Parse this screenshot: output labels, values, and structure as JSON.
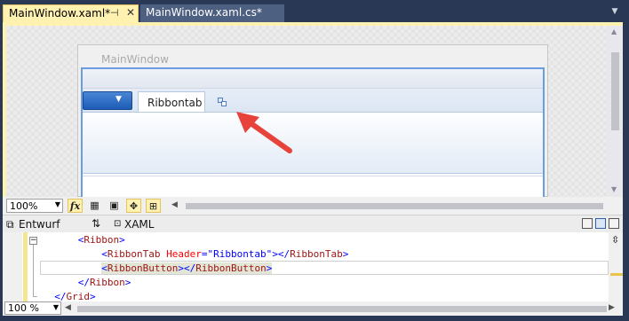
{
  "tabs": [
    {
      "label": "MainWindow.xaml*",
      "pin_icon": "pin-icon",
      "close_glyph": "✕"
    },
    {
      "label": "MainWindow.xaml.cs*"
    }
  ],
  "designer": {
    "window_title": "MainWindow",
    "ribbon_tab_label": "Ribbontab",
    "arrow_color": "#e8433a"
  },
  "designer_toolbar": {
    "zoom": "100%",
    "fx_label": "fx"
  },
  "split": {
    "design_tab": "Entwurf",
    "swap_glyph": "⇅",
    "xaml_tab": "XAML"
  },
  "code": {
    "lines": [
      {
        "indent": "      ",
        "open": "<",
        "tag": "Ribbon",
        "close": ">"
      },
      {
        "indent": "          ",
        "open": "<",
        "tag": "RibbonTab",
        "attr": " Header",
        "eq": "=",
        "val": "\"Ribbontab\"",
        "mid": "></",
        "tag2": "RibbonTab",
        "end": ">"
      },
      {
        "indent": "          ",
        "open": "<",
        "tag": "RibbonButton",
        "mid": "></",
        "tag2": "RibbonButton",
        "end": ">"
      },
      {
        "indent": "      ",
        "open": "</",
        "tag": "Ribbon",
        "close": ">"
      },
      {
        "indent": "  ",
        "open": "</",
        "tag": "Grid",
        "close": ">"
      }
    ]
  },
  "bottom_bar": {
    "zoom": "100 %"
  },
  "colors": {
    "chrome": "#293955",
    "active_tab": "#fff1b0",
    "ribbon_blue": "#6b9ee0"
  }
}
